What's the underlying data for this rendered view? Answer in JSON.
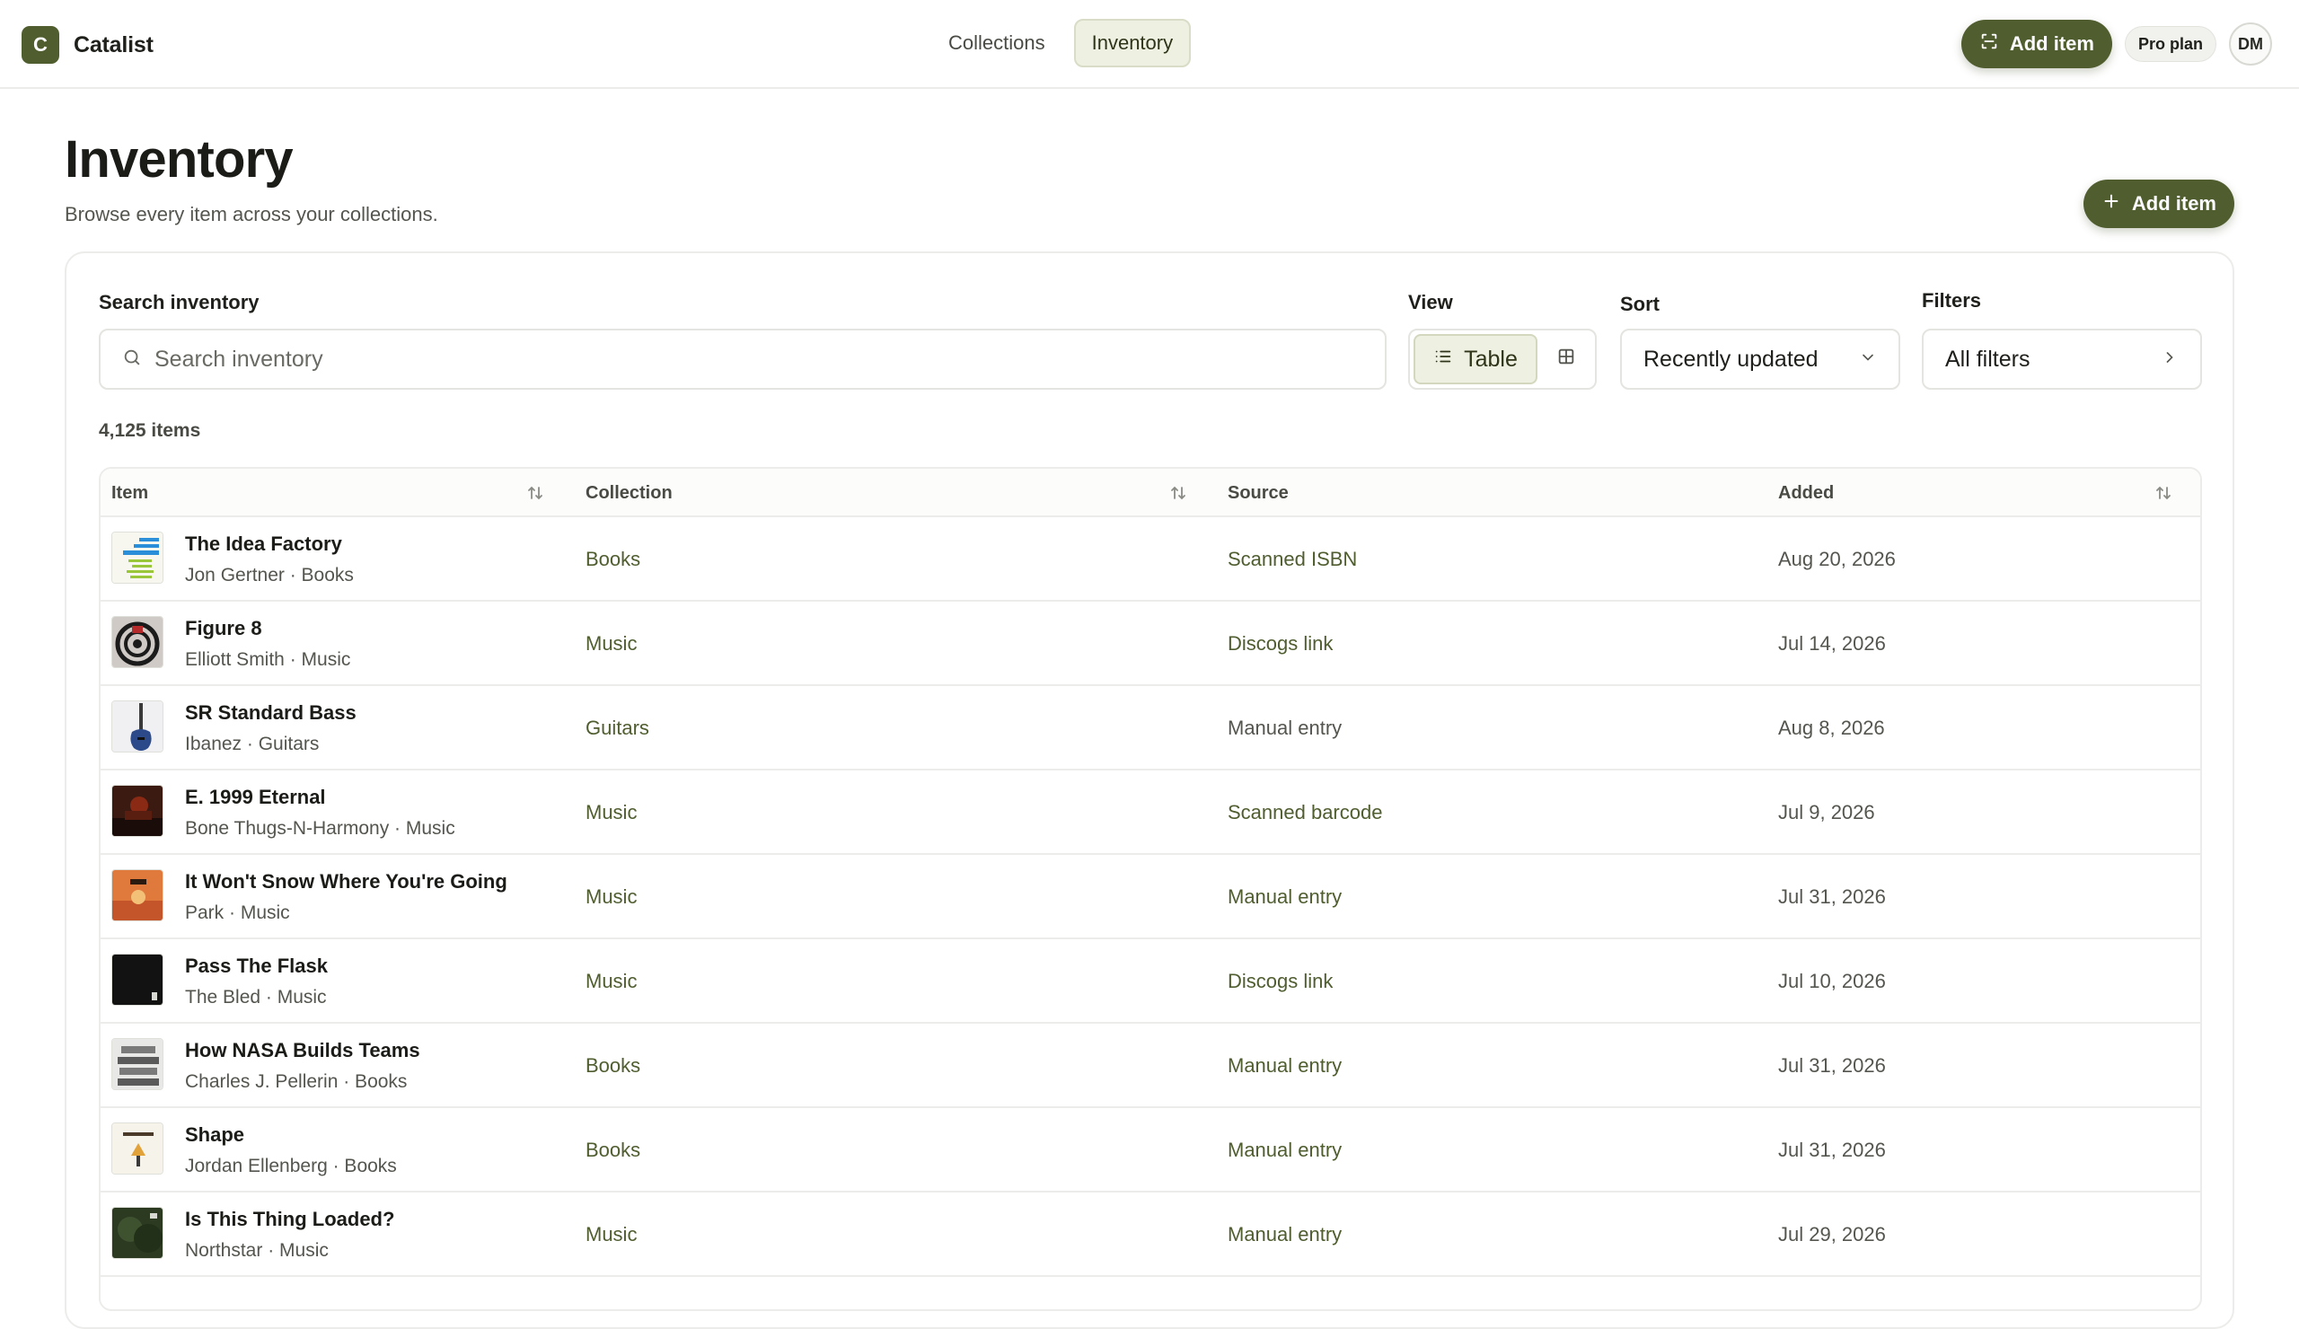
{
  "app": {
    "logo_letter": "C",
    "name": "Catalist"
  },
  "nav": {
    "tabs": [
      {
        "label": "Collections"
      },
      {
        "label": "Inventory"
      }
    ]
  },
  "top_actions": {
    "add_item": "Add item",
    "plan": "Pro plan",
    "avatar": "DM"
  },
  "header": {
    "title": "Inventory",
    "subtitle": "Browse every item across your collections.",
    "add_item": "Add item"
  },
  "search": {
    "label": "Search inventory",
    "placeholder": "Search inventory",
    "value": ""
  },
  "view": {
    "label": "View",
    "table_label": "Table"
  },
  "sort": {
    "label": "Sort",
    "value": "Recently updated"
  },
  "filters": {
    "label": "Filters",
    "value": "All filters"
  },
  "count": "4,125 items",
  "table": {
    "columns": {
      "item": "Item",
      "collection": "Collection",
      "source": "Source",
      "added": "Added"
    },
    "rows": [
      {
        "title": "The Idea Factory",
        "subtitle": "Jon Gertner · Books",
        "collection": "Books",
        "source": "Scanned ISBN",
        "added": "Aug 20, 2026"
      },
      {
        "title": "Figure 8",
        "subtitle": "Elliott Smith · Music",
        "collection": "Music",
        "source": "Discogs link",
        "added": "Jul 14, 2026"
      },
      {
        "title": "SR Standard Bass",
        "subtitle": "Ibanez · Guitars",
        "collection": "Guitars",
        "source": "Manual entry",
        "added": "Aug 8, 2026"
      },
      {
        "title": "E. 1999 Eternal",
        "subtitle": "Bone Thugs-N-Harmony · Music",
        "collection": "Music",
        "source": "Scanned barcode",
        "added": "Jul 9, 2026"
      },
      {
        "title": "It Won't Snow Where You're Going",
        "subtitle": "Park · Music",
        "collection": "Music",
        "source": "Manual entry",
        "added": "Jul 31, 2026"
      },
      {
        "title": "Pass The Flask",
        "subtitle": "The Bled · Music",
        "collection": "Music",
        "source": "Discogs link",
        "added": "Jul 10, 2026"
      },
      {
        "title": "How NASA Builds Teams",
        "subtitle": "Charles J. Pellerin · Books",
        "collection": "Books",
        "source": "Manual entry",
        "added": "Jul 31, 2026"
      },
      {
        "title": "Shape",
        "subtitle": "Jordan Ellenberg · Books",
        "collection": "Books",
        "source": "Manual entry",
        "added": "Jul 31, 2026"
      },
      {
        "title": "Is This Thing Loaded?",
        "subtitle": "Northstar · Music",
        "collection": "Music",
        "source": "Manual entry",
        "added": "Jul 29, 2026"
      }
    ]
  },
  "colors": {
    "accent": "#4f5d2f",
    "accent_soft": "#eef0e2",
    "border": "#ececea"
  }
}
